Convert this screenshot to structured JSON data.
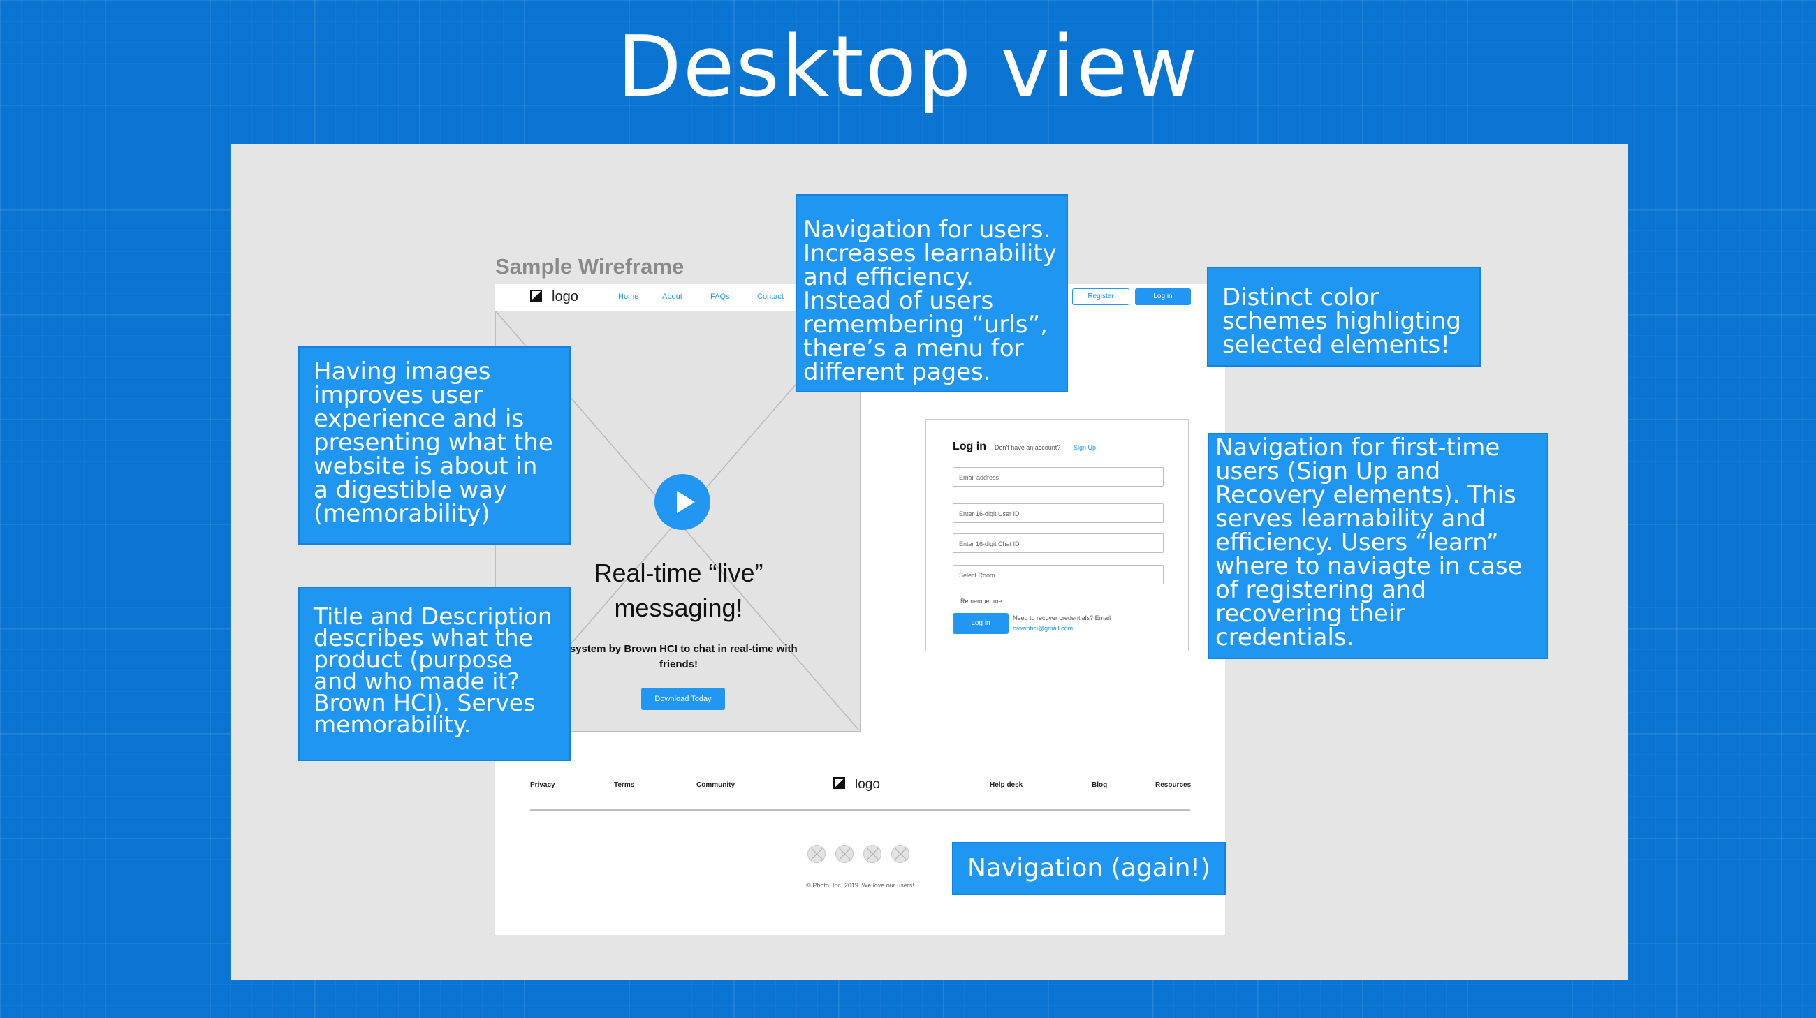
{
  "slide": {
    "title": "Desktop view"
  },
  "wireframe": {
    "label": "Sample Wireframe",
    "nav": {
      "logo": "logo",
      "links": [
        "Home",
        "About",
        "FAQs",
        "Contact"
      ],
      "register": "Register",
      "login": "Log in"
    },
    "hero": {
      "title": "Real-time “live”\nmessaging!",
      "description": "A system by Brown HCI to chat in real-time with friends!",
      "cta": "Download Today"
    },
    "login": {
      "heading": "Log in",
      "prompt": "Don't have an account?",
      "signup": "Sign Up",
      "fields": [
        "Email address",
        "Enter 16-digit User ID",
        "Enter 16-digit Chat ID",
        "Select Room"
      ],
      "remember": "Remember me",
      "submit": "Log in",
      "recover_text": "Need to recover credentials? Email",
      "recover_email": "brownhci@gmail.com"
    },
    "footer": {
      "links_left": [
        "Privacy",
        "Terms",
        "Community"
      ],
      "logo": "logo",
      "links_right": [
        "Help desk",
        "Blog",
        "Resources"
      ],
      "copyright": "© Photo, Inc. 2019. We love our users!"
    }
  },
  "annotations": {
    "images": "Having images improves user experience and is presenting what the website is about in a digestible way (memorability)",
    "title_desc": "Title and Description describes what the product (purpose and who made it? Brown HCI). Serves memorability.",
    "navigation": "Navigation for users. Increases learnability and efficiency. Instead of users remembering “urls”, there’s a menu for different pages.",
    "color": "Distinct color schemes highligting selected elements!",
    "first_time": "Navigation for first-time users (Sign Up and Recovery elements). This serves learnability and efficiency. Users “learn” where to naviagte in case of registering and recovering their credentials.",
    "again": "Navigation (again!)"
  },
  "colors": {
    "background": "#0a74d2",
    "accent": "#2196f3",
    "frame": "#e5e5e5"
  }
}
